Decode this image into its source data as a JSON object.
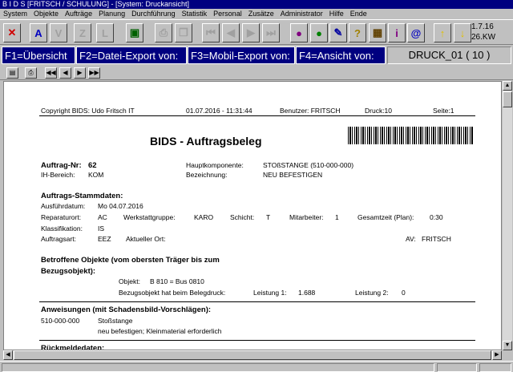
{
  "window": {
    "title": "B I D S  [FRITSCH / SCHULUNG] - [System: Druckansicht]"
  },
  "menu": [
    "System",
    "Objekte",
    "Aufträge",
    "Planung",
    "Durchführung",
    "Statistik",
    "Personal",
    "Zusätze",
    "Administrator",
    "Hilfe",
    "Ende"
  ],
  "version": {
    "line1": "1.7.16",
    "line2": "26.KW"
  },
  "fkeys": {
    "f1": "F1=Übersicht",
    "f2": "F2=Datei-Export von:",
    "f3": "F3=Mobil-Export von:",
    "f4": "F4=Ansicht von:",
    "druck": "DRUCK_01 ( 10 )"
  },
  "doc": {
    "header": {
      "copyright": "Copyright BIDS: Udo Fritsch IT",
      "datetime": "01.07.2016 - 11:31:44",
      "user": "Benutzer: FRITSCH",
      "druck": "Druck:10",
      "seite": "Seite:1"
    },
    "title": "BIDS - Auftragsbeleg",
    "auftrag": {
      "nr_label": "Auftrag-Nr:",
      "nr": "62",
      "ih_label": "IH-Bereich:",
      "ih": "KOM",
      "hk_label": "Hauptkomponente:",
      "hk": "STOßSTANGE (510-000-000)",
      "bez_label": "Bezeichnung:",
      "bez": "NEU BEFESTIGEN"
    },
    "stamm": {
      "heading": "Auftrags-Stammdaten:",
      "ausf_label": "Ausführdatum:",
      "ausf": "Mo 04.07.2016",
      "rep_label": "Reparaturort:",
      "rep": "AC",
      "wg_label": "Werkstattgruppe:",
      "wg": "KARO",
      "schicht_label": "Schicht:",
      "schicht": "T",
      "mit_label": "Mitarbeiter:",
      "mit": "1",
      "gz_label": "Gesamtzeit (Plan):",
      "gz": "0:30",
      "kl_label": "Klassifikation:",
      "kl": "IS",
      "art_label": "Auftragsart:",
      "art": "EEZ",
      "ort_label": "Aktueller Ort:",
      "av_label": "AV:",
      "av": "FRITSCH"
    },
    "objekte": {
      "heading1": "Betroffene Objekte (vom obersten Träger bis zum",
      "heading2": "Bezugsobjekt):",
      "obj_label": "Objekt:",
      "obj": "B  810  = Bus 0810",
      "bezug": "Bezugsobjekt hat beim Belegdruck:",
      "l1_label": "Leistung 1:",
      "l1": "1.688",
      "l2_label": "Leistung 2:",
      "l2": "0"
    },
    "anw": {
      "heading": "Anweisungen (mit Schadensbild-Vorschlägen):",
      "code": "510-000-000",
      "name": "Stoßstange",
      "text": "neu befestigen; Kleinmaterial erforderlich"
    },
    "rueck": {
      "heading": "Rückmeldedaten:"
    }
  }
}
